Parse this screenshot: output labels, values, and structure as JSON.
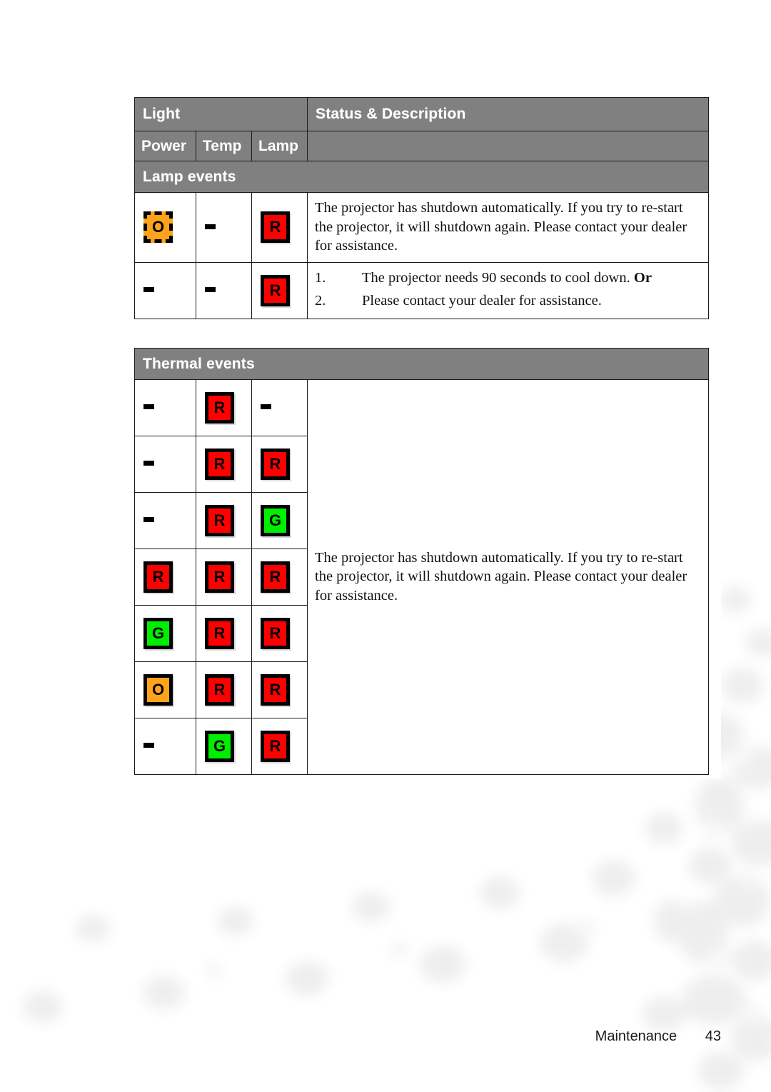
{
  "page": {
    "footer_section": "Maintenance",
    "footer_page_number": "43"
  },
  "colors": {
    "header_gray": "#808080",
    "led_red": "#FF0000",
    "led_green": "#00EE00",
    "led_orange": "#FFA31A",
    "border_black": "#000000"
  },
  "lamp_table": {
    "header": {
      "light": "Light",
      "status_description": "Status & Description",
      "power": "Power",
      "temp": "Temp",
      "lamp": "Lamp"
    },
    "band_title": "Lamp events",
    "rows": [
      {
        "power": {
          "state": "orange-blink",
          "label": "O"
        },
        "temp": {
          "state": "off",
          "label": "-"
        },
        "lamp": {
          "state": "red",
          "label": "R"
        },
        "description": "The projector has shutdown automatically. If you try to re-start the projector, it will shutdown again. Please contact your dealer for assistance."
      },
      {
        "power": {
          "state": "off",
          "label": "-"
        },
        "temp": {
          "state": "off",
          "label": "-"
        },
        "lamp": {
          "state": "red",
          "label": "R"
        },
        "list": [
          {
            "num": "1.",
            "text": "The projector needs 90 seconds to cool down. ",
            "bold_suffix": "Or"
          },
          {
            "num": "2.",
            "text": "Please contact your dealer for assistance.",
            "bold_suffix": ""
          }
        ]
      }
    ]
  },
  "thermal_table": {
    "band_title": "Thermal events",
    "description": "The projector has shutdown automatically. If you try to re-start the projector, it will shutdown again. Please contact your dealer for assistance.",
    "rows": [
      {
        "power": {
          "state": "off",
          "label": "-"
        },
        "temp": {
          "state": "red",
          "label": "R"
        },
        "lamp": {
          "state": "off",
          "label": "-"
        }
      },
      {
        "power": {
          "state": "off",
          "label": "-"
        },
        "temp": {
          "state": "red",
          "label": "R"
        },
        "lamp": {
          "state": "red",
          "label": "R"
        }
      },
      {
        "power": {
          "state": "off",
          "label": "-"
        },
        "temp": {
          "state": "red",
          "label": "R"
        },
        "lamp": {
          "state": "green",
          "label": "G"
        }
      },
      {
        "power": {
          "state": "red",
          "label": "R"
        },
        "temp": {
          "state": "red",
          "label": "R"
        },
        "lamp": {
          "state": "red",
          "label": "R"
        }
      },
      {
        "power": {
          "state": "green",
          "label": "G"
        },
        "temp": {
          "state": "red",
          "label": "R"
        },
        "lamp": {
          "state": "red",
          "label": "R"
        }
      },
      {
        "power": {
          "state": "orange",
          "label": "O"
        },
        "temp": {
          "state": "red",
          "label": "R"
        },
        "lamp": {
          "state": "red",
          "label": "R"
        }
      },
      {
        "power": {
          "state": "off",
          "label": "-"
        },
        "temp": {
          "state": "green",
          "label": "G"
        },
        "lamp": {
          "state": "red",
          "label": "R"
        }
      }
    ]
  }
}
